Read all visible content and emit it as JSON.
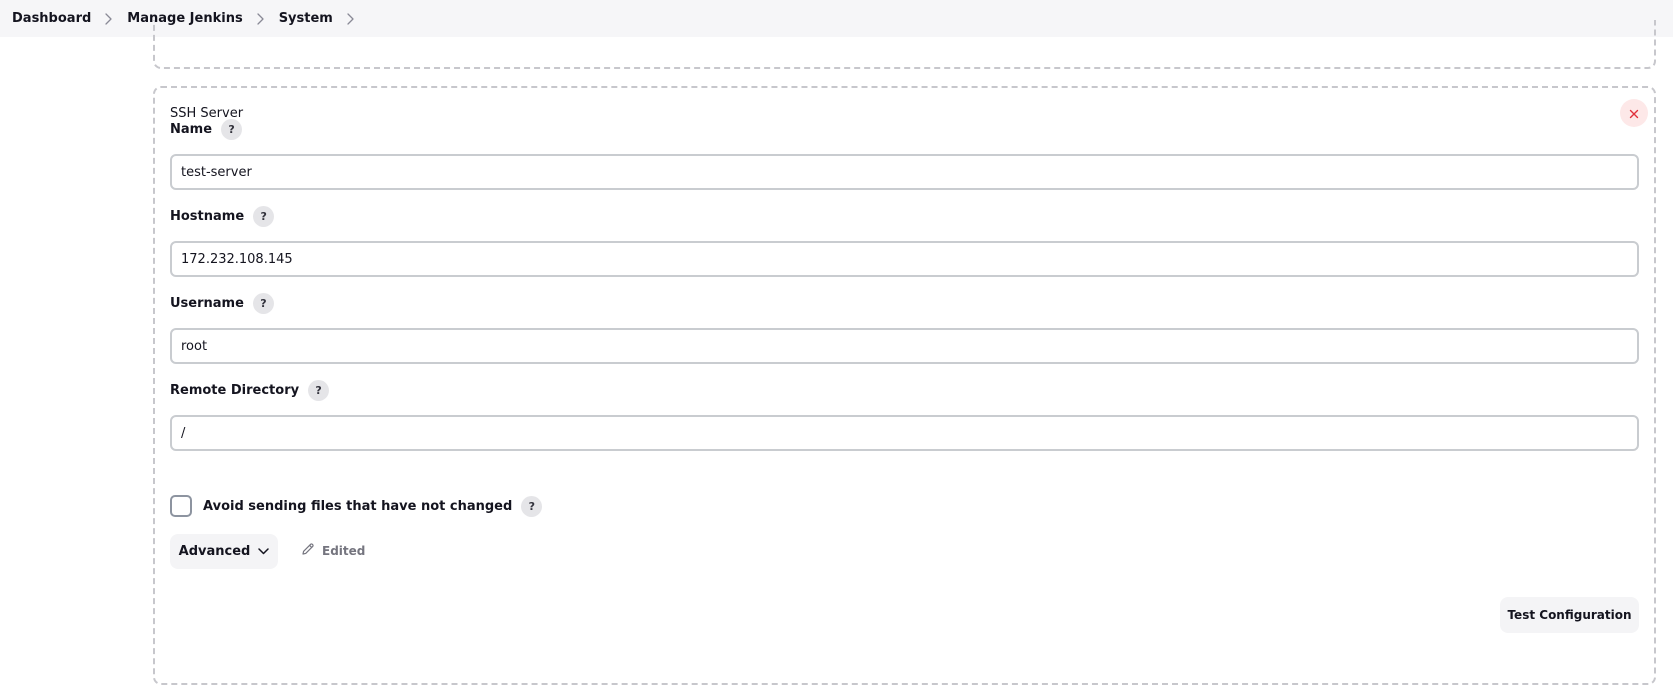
{
  "breadcrumb": {
    "items": [
      "Dashboard",
      "Manage Jenkins",
      "System"
    ]
  },
  "ssh_server": {
    "title": "SSH Server",
    "fields": {
      "name": {
        "label": "Name",
        "value": "test-server"
      },
      "hostname": {
        "label": "Hostname",
        "value": "172.232.108.145"
      },
      "username": {
        "label": "Username",
        "value": "root"
      },
      "remote_directory": {
        "label": "Remote Directory",
        "value": "/"
      }
    },
    "avoid_sending": {
      "label": "Avoid sending files that have not changed",
      "checked": false
    },
    "advanced_label": "Advanced",
    "edited_label": "Edited",
    "test_button_label": "Test Configuration",
    "help_glyph": "?",
    "close_icon": "close-icon"
  },
  "colors": {
    "close_accent": "#e0303c",
    "close_bg": "#fde8e8"
  }
}
